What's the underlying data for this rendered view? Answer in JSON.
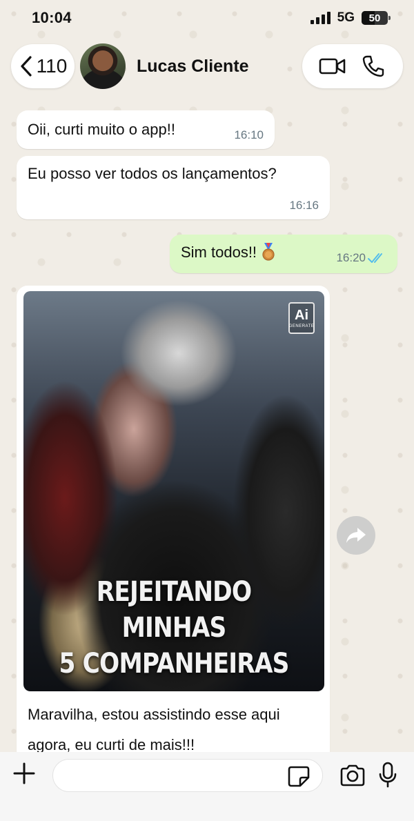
{
  "status_bar": {
    "time": "10:04",
    "network": "5G",
    "battery": "50"
  },
  "header": {
    "back_count": "110",
    "contact_name": "Lucas Cliente"
  },
  "messages": [
    {
      "direction": "in",
      "text": "Oii, curti muito o app!!",
      "time": "16:10"
    },
    {
      "direction": "in",
      "text": "Eu posso ver todos os lançamentos?",
      "time": "16:16"
    },
    {
      "direction": "out",
      "text": "Sim todos!!",
      "time": "16:20",
      "status": "read"
    },
    {
      "direction": "in",
      "media": {
        "badge": "Ai",
        "badge_sub": "GENERATE",
        "title_line1": "REJEITANDO MINHAS",
        "title_line2": "5 COMPANHEIRAS"
      },
      "text": "Maravilha, estou assistindo esse aqui agora, eu curti de mais!!!"
    }
  ],
  "composer": {
    "value": "",
    "placeholder": ""
  },
  "colors": {
    "outgoing": "#dcf8c6",
    "incoming": "#ffffff",
    "read_ticks": "#53bdeb",
    "background": "#efeae2"
  },
  "icons": [
    "back-chevron-icon",
    "video-call-icon",
    "phone-icon",
    "forward-icon",
    "plus-icon",
    "sticker-icon",
    "camera-icon",
    "mic-icon",
    "medal-icon",
    "double-check-icon"
  ]
}
